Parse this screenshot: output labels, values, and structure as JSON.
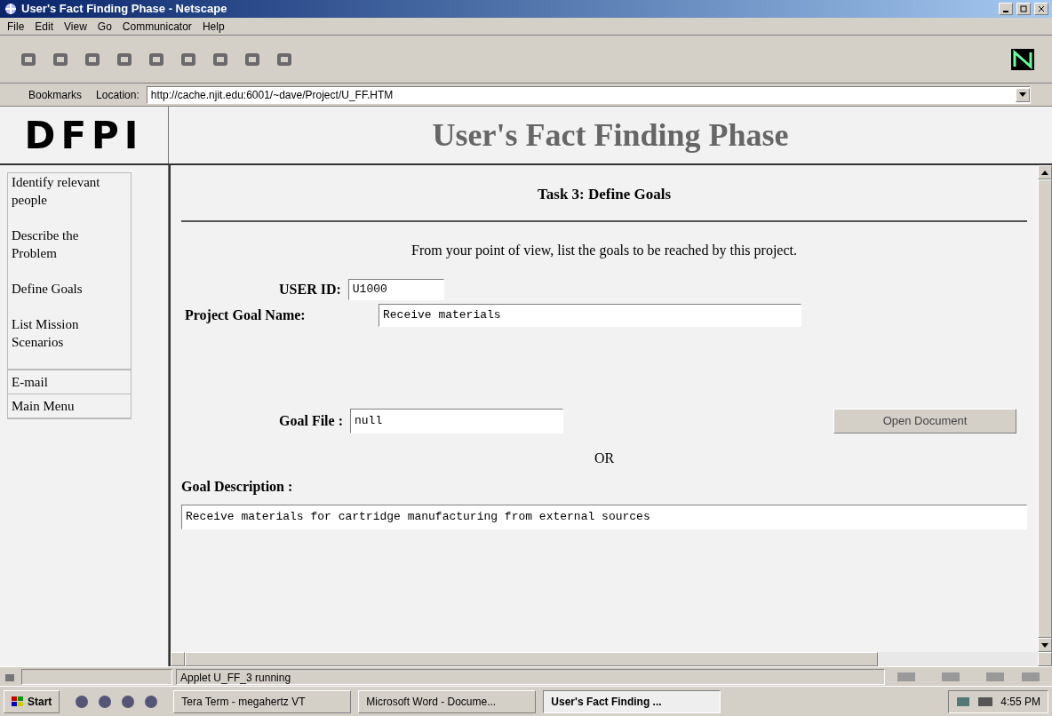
{
  "window": {
    "title": "User's Fact Finding Phase - Netscape"
  },
  "menu": [
    "File",
    "Edit",
    "View",
    "Go",
    "Communicator",
    "Help"
  ],
  "location_bar": {
    "bookmarks": "Bookmarks",
    "label": "Location:",
    "url": "http://cache.njit.edu:6001/~dave/Project/U_FF.HTM"
  },
  "header": {
    "logo": "DFPI",
    "title": "User's Fact Finding Phase"
  },
  "sidebar": {
    "task_links": [
      "Identify relevant people",
      "Describe the Problem",
      "Define Goals",
      "List Mission Scenarios"
    ],
    "other_links": [
      "E-mail",
      "Main Menu"
    ]
  },
  "form": {
    "task_title": "Task 3: Define Goals",
    "instruction": "From your point of view, list the goals to be reached by this project.",
    "user_id": {
      "label": "USER ID:",
      "value": "U1000"
    },
    "goal_name": {
      "label": "Project Goal Name:",
      "value": "Receive materials"
    },
    "goal_file": {
      "label": "Goal File :",
      "value": "null"
    },
    "open_button": "Open Document",
    "or": "OR",
    "goal_description": {
      "label": "Goal Description :",
      "value": "Receive materials for cartridge manufacturing from external sources"
    }
  },
  "status_bar": {
    "text": "Applet U_FF_3 running"
  },
  "taskbar": {
    "start": "Start",
    "tasks": [
      {
        "label": "Tera Term - megahertz VT",
        "selected": false
      },
      {
        "label": "Microsoft Word - Docume...",
        "selected": false
      },
      {
        "label": "User's Fact Finding ...",
        "selected": true
      }
    ],
    "clock": "4:55 PM"
  }
}
